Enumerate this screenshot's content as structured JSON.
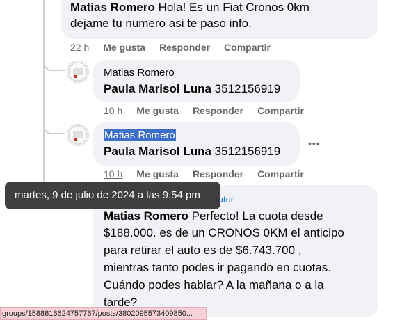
{
  "comment1": {
    "author": "Matias Romero",
    "text_line1": "Hola! Es un Fiat Cronos 0km",
    "text_line2": "dejame tu numero asi te paso info.",
    "time": "22 h",
    "like": "Me gusta",
    "reply": "Responder",
    "share": "Compartir"
  },
  "reply1": {
    "author": "Matias Romero",
    "mention": "Paula Marisol Luna",
    "phone": "3512156919",
    "time": "10 h",
    "like": "Me gusta",
    "reply": "Responder",
    "share": "Compartir"
  },
  "reply2": {
    "author": "Matias Romero",
    "mention": "Paula Marisol Luna",
    "phone": "3512156919",
    "time": "10 h",
    "like": "Me gusta",
    "reply": "Responder",
    "share": "Compartir",
    "more": "•••"
  },
  "reply3": {
    "badge": "Autor",
    "author": "Matias Romero",
    "text_first": "Perfecto! La cuota desde",
    "line2": "$188.000. es de un CRONOS 0KM el anticipo",
    "line3": "para retirar el auto es de $6.743.700 ,",
    "line4": "mientras tanto podes ir pagando en cuotas.",
    "line5": "Cuándo podes hablar? A la mañana o a la",
    "line6": "tarde?"
  },
  "tooltip": "martes, 9 de julio de 2024 a las 9:54 pm",
  "status_url": "groups/1588616624757767/posts/3802095573409850..."
}
